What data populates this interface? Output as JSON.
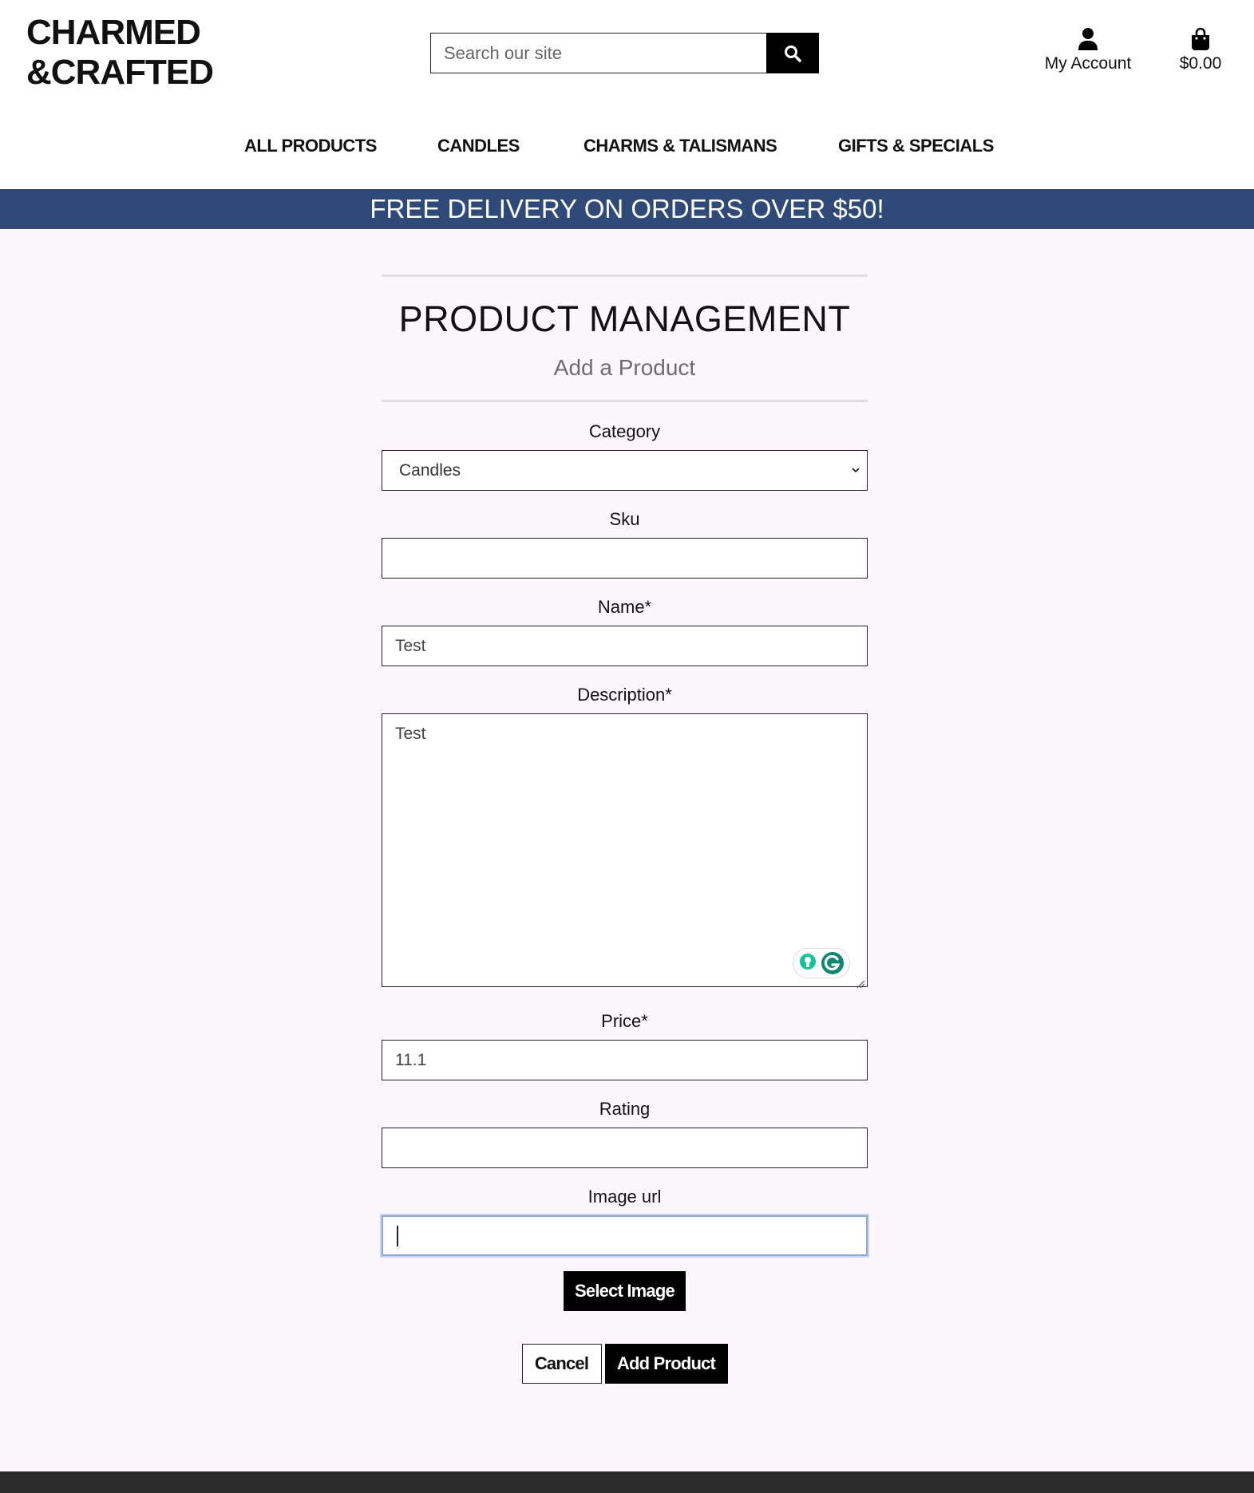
{
  "brand": {
    "line1": "CHARMED",
    "line2": "&CRAFTED"
  },
  "search": {
    "placeholder": "Search our site",
    "icon": "search-icon"
  },
  "account": {
    "label": "My Account",
    "icon": "user-icon"
  },
  "cart": {
    "total": "$0.00",
    "icon": "shopping-bag-icon"
  },
  "nav": {
    "items": [
      {
        "label": "ALL PRODUCTS"
      },
      {
        "label": "CANDLES"
      },
      {
        "label": "CHARMS & TALISMANS"
      },
      {
        "label": "GIFTS & SPECIALS"
      }
    ]
  },
  "banner": {
    "text": "FREE DELIVERY ON ORDERS OVER $50!"
  },
  "page": {
    "title": "PRODUCT MANAGEMENT",
    "subtitle": "Add a Product"
  },
  "form": {
    "category": {
      "label": "Category",
      "value": "Candles"
    },
    "sku": {
      "label": "Sku",
      "value": ""
    },
    "name": {
      "label": "Name*",
      "value": "Test"
    },
    "description": {
      "label": "Description*",
      "value": "Test"
    },
    "price": {
      "label": "Price*",
      "value": "11.1"
    },
    "rating": {
      "label": "Rating",
      "value": ""
    },
    "image_url": {
      "label": "Image url",
      "value": ""
    },
    "select_image": "Select Image",
    "cancel": "Cancel",
    "submit": "Add Product"
  },
  "colors": {
    "banner": "#2f4a78",
    "page_bg": "#fcf7fd",
    "footer": "#2b2b2b",
    "grammarly": "#13866f"
  }
}
